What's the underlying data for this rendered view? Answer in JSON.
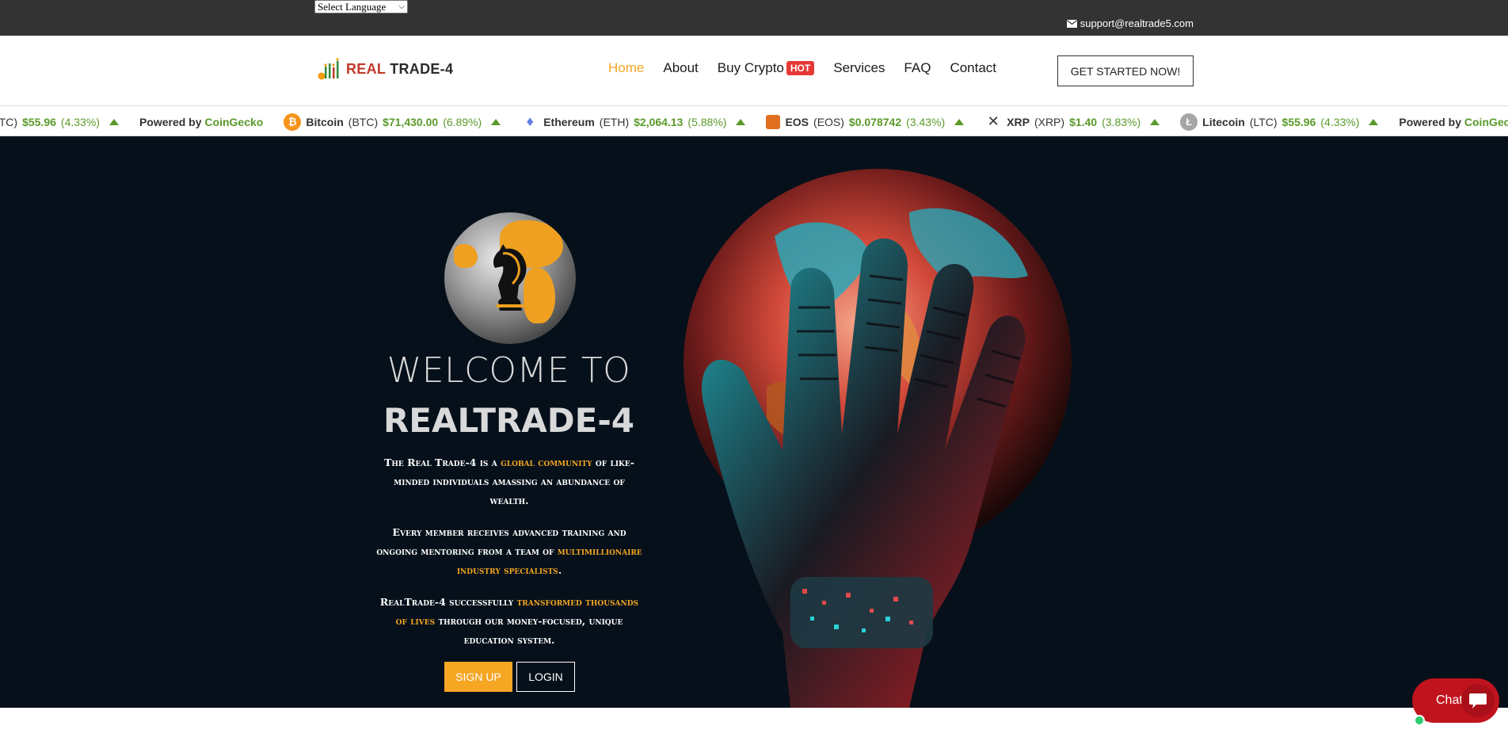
{
  "topbar": {
    "language_select": "Select Language",
    "support_email": "support@realtrade5.com"
  },
  "header": {
    "logo": {
      "part1": "REAL",
      "part2": "TRADE-4"
    },
    "nav": [
      {
        "label": "Home",
        "active": true
      },
      {
        "label": "About"
      },
      {
        "label": "Buy Crypto",
        "badge": "HOT"
      },
      {
        "label": "Services"
      },
      {
        "label": "FAQ"
      },
      {
        "label": "Contact"
      }
    ],
    "cta_label": "GET STARTED NOW!"
  },
  "ticker": {
    "lead_fragment": {
      "symbol": "LTC)",
      "price": "$55.96",
      "change": "(4.33%)"
    },
    "powered_by": "Powered by",
    "powered_brand": "CoinGecko",
    "coins": [
      {
        "icon": "bitcoin-icon",
        "name": "Bitcoin",
        "symbol": "(BTC)",
        "price": "$71,430.00",
        "change": "(6.89%)"
      },
      {
        "icon": "ethereum-icon",
        "name": "Ethereum",
        "symbol": "(ETH)",
        "price": "$2,064.13",
        "change": "(5.88%)"
      },
      {
        "icon": "eos-icon",
        "name": "EOS",
        "symbol": "(EOS)",
        "price": "$0.078742",
        "change": "(3.43%)"
      },
      {
        "icon": "xrp-icon",
        "name": "XRP",
        "symbol": "(XRP)",
        "price": "$1.40",
        "change": "(3.83%)"
      },
      {
        "icon": "litecoin-icon",
        "name": "Litecoin",
        "symbol": "(LTC)",
        "price": "$55.96",
        "change": "(4.33%)"
      }
    ],
    "up_color": "#5a9a2a"
  },
  "hero": {
    "welcome": "WELCOME TO",
    "brand": "REALTRADE-4",
    "p1": {
      "a": "The Real Trade-4 is a ",
      "hl": "global community",
      "b": " of like-minded individuals amassing an abundance of wealth."
    },
    "p2": {
      "a": "Every member receives advanced training and ongoing mentoring from a team of ",
      "hl": "multimillionaire industry specialists",
      "b": "."
    },
    "p3": {
      "a": "RealTrade-4 successfully ",
      "hl": "transformed thousands of lives",
      "b": " through our money-focused, unique education system."
    },
    "signup_label": "SIGN UP",
    "login_label": "LOGIN",
    "accent": "#f5a623"
  },
  "chat": {
    "label": "Chat"
  }
}
